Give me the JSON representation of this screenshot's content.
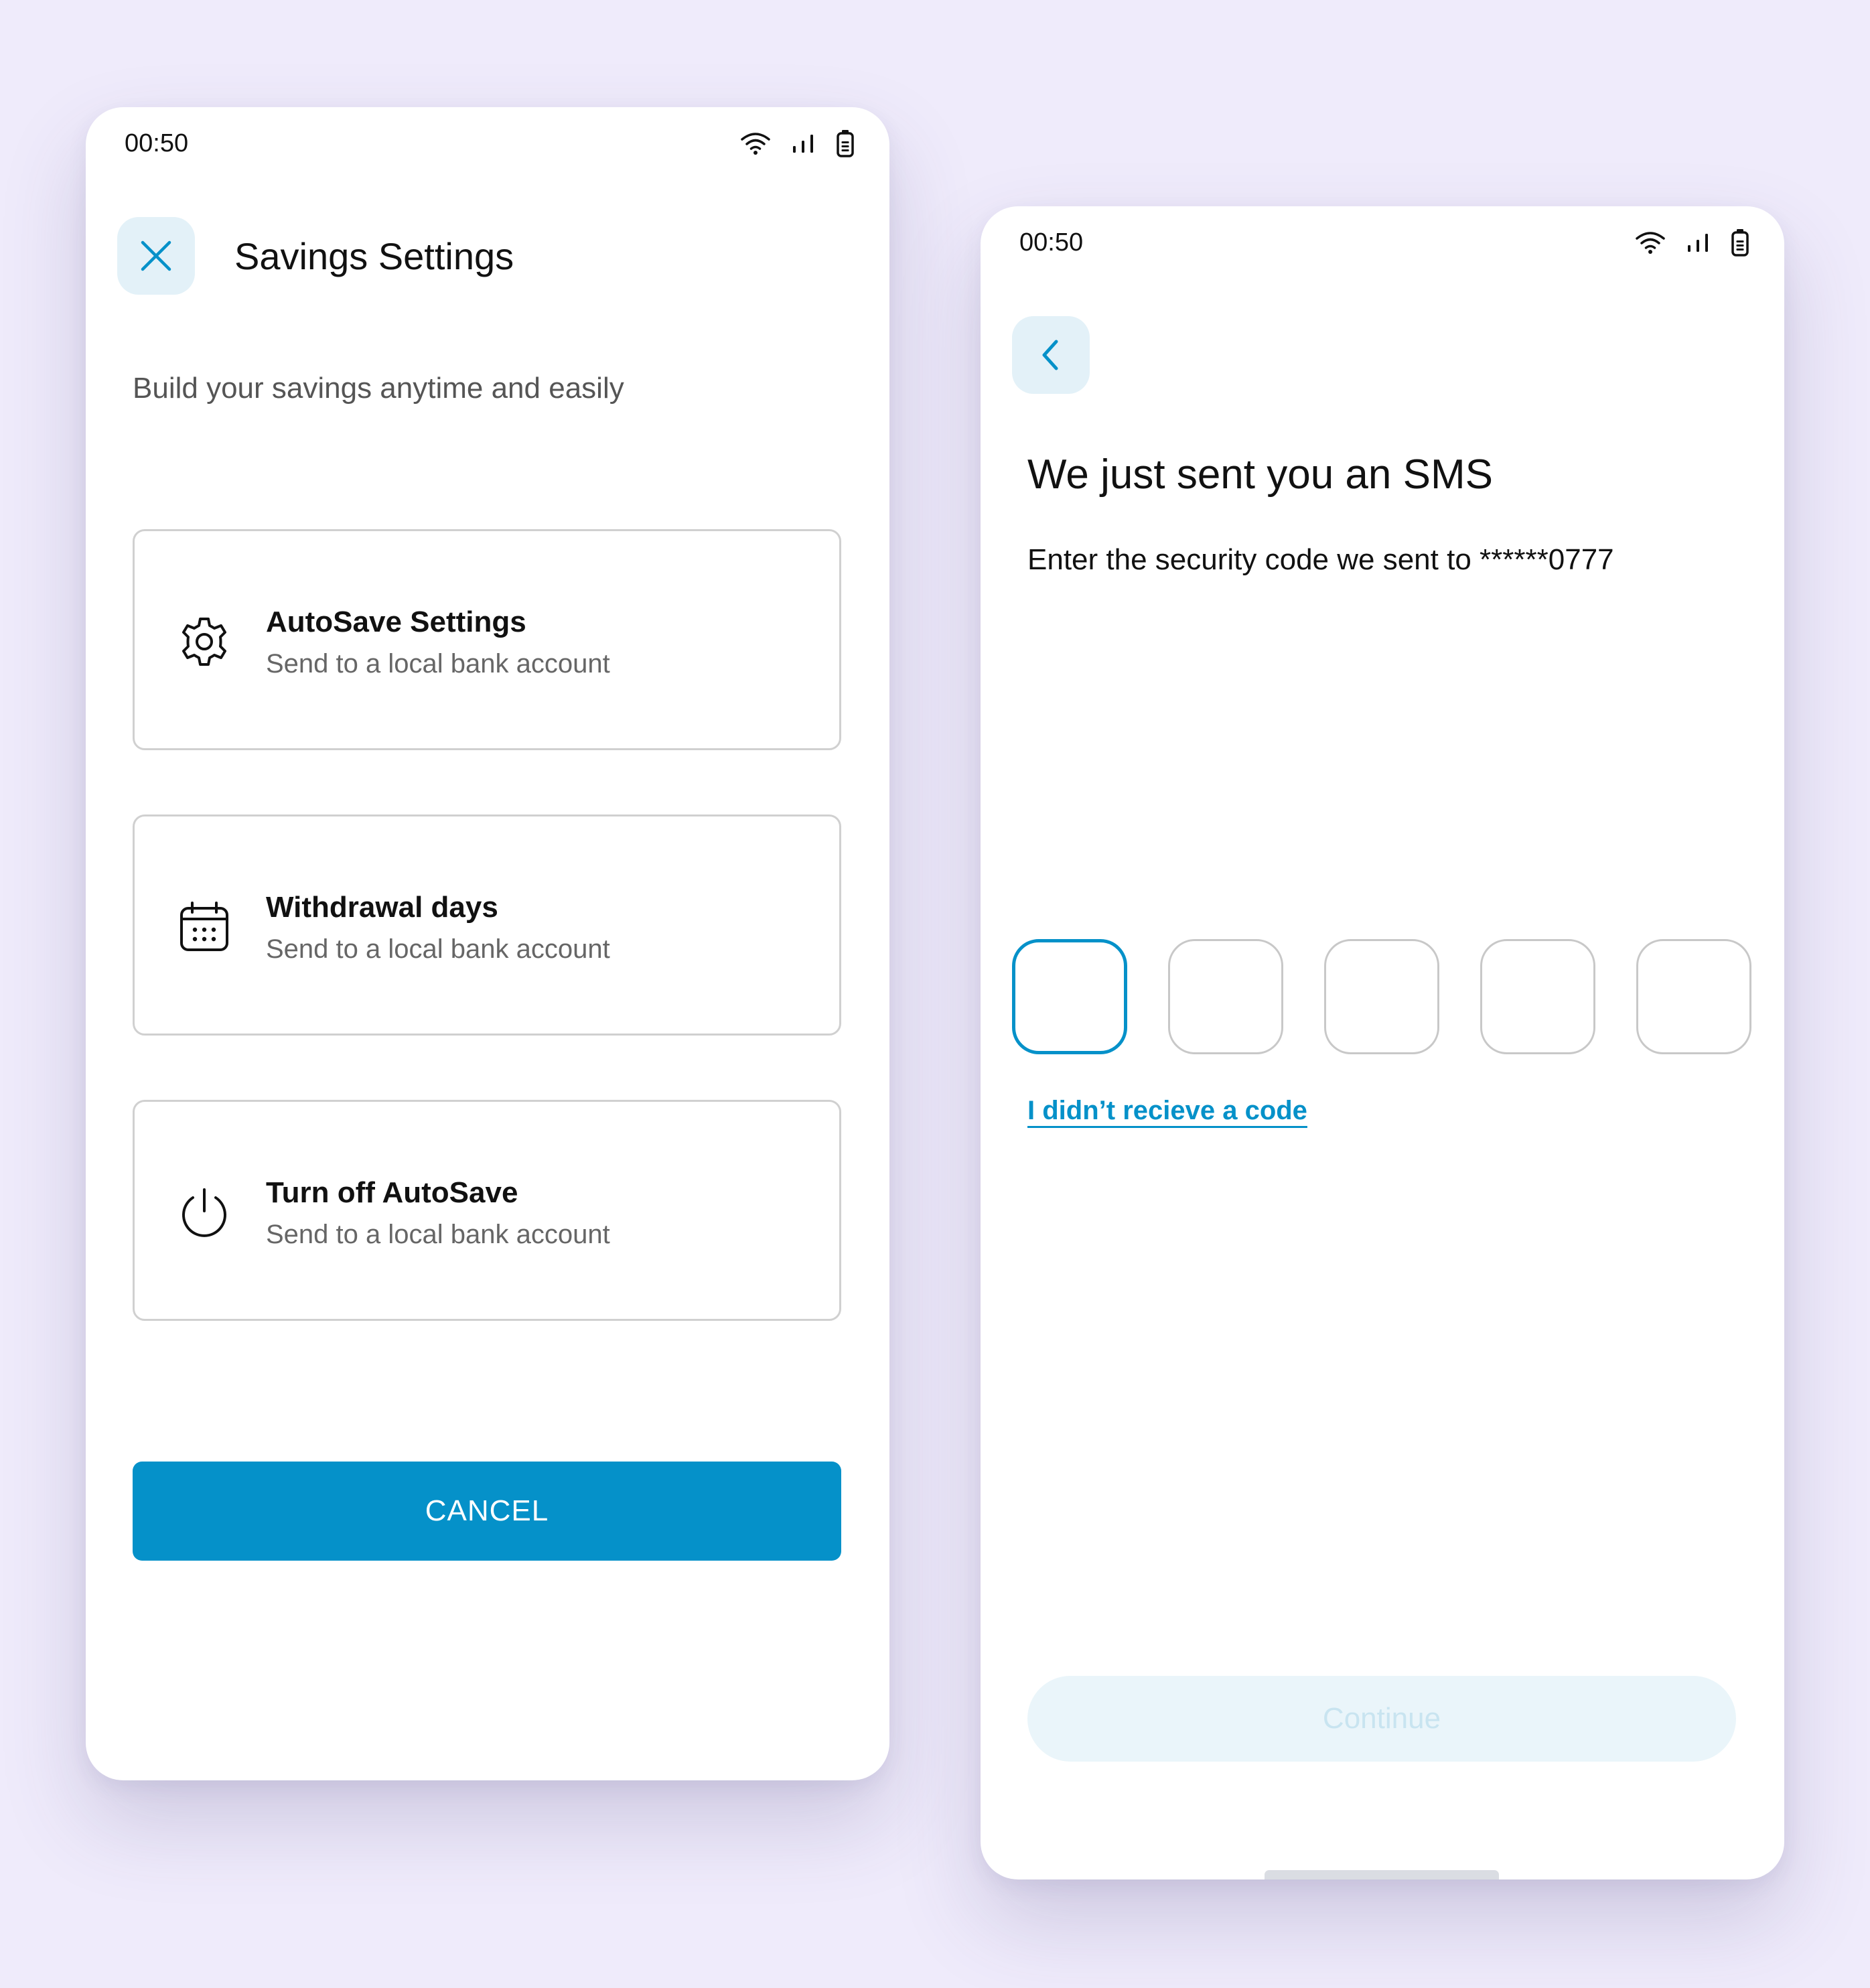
{
  "colors": {
    "background": "#EFEBFB",
    "accent": "#0591C9",
    "icon_button_bg": "#E3F1F8",
    "continue_disabled_bg": "#EAF5FA",
    "continue_disabled_text": "#C8E4F0"
  },
  "savings_screen": {
    "status_bar": {
      "time": "00:50",
      "icons": [
        "wifi-icon",
        "signal-icon",
        "battery-icon"
      ]
    },
    "close_icon": "close-icon",
    "title": "Savings Settings",
    "subtitle": "Build your savings anytime and easily",
    "options": [
      {
        "icon": "gear-icon",
        "title": "AutoSave Settings",
        "subtitle": "Send to a local bank account"
      },
      {
        "icon": "calendar-icon",
        "title": "Withdrawal days",
        "subtitle": "Send to a local bank account"
      },
      {
        "icon": "power-icon",
        "title": "Turn off AutoSave",
        "subtitle": "Send to a local bank account"
      }
    ],
    "cancel_label": "CANCEL"
  },
  "sms_screen": {
    "status_bar": {
      "time": "00:50",
      "icons": [
        "wifi-icon",
        "signal-icon",
        "battery-icon"
      ]
    },
    "back_icon": "chevron-left-icon",
    "title": "We just sent you an SMS",
    "message": "Enter the security code we sent to ******0777",
    "code_digits": [
      "",
      "",
      "",
      "",
      ""
    ],
    "resend_label": "I didn’t recieve a code",
    "continue_label": "Continue"
  }
}
